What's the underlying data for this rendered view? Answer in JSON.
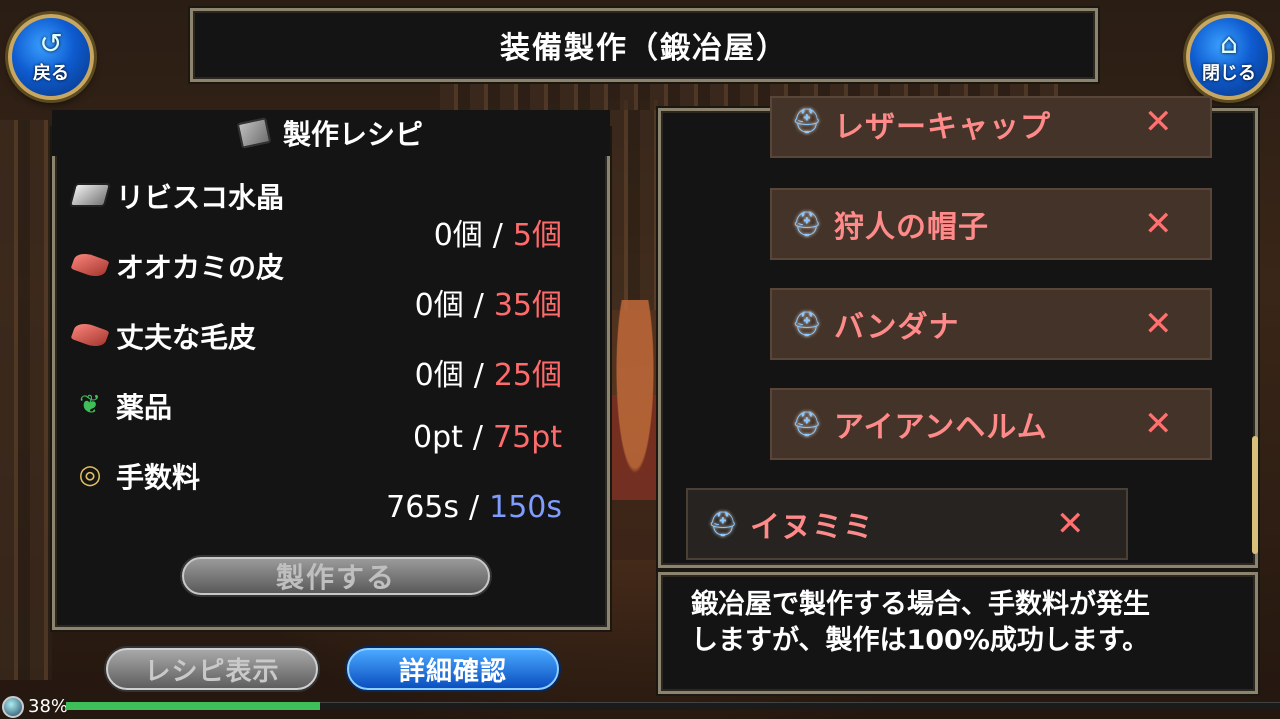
{
  "header": {
    "title": "装備製作（鍛冶屋）"
  },
  "nav": {
    "back_label": "戻る",
    "close_label": "閉じる"
  },
  "recipe": {
    "title": "製作レシピ",
    "materials": [
      {
        "name": "リビスコ水晶",
        "have": "0個",
        "need": "5個",
        "icon": "crystal-icon"
      },
      {
        "name": "オオカミの皮",
        "have": "0個",
        "need": "35個",
        "icon": "wolf-hide-icon"
      },
      {
        "name": "丈夫な毛皮",
        "have": "0個",
        "need": "25個",
        "icon": "fur-icon"
      },
      {
        "name": "薬品",
        "have": "0pt",
        "need": "75pt",
        "icon": "herb-icon"
      },
      {
        "name": "手数料",
        "have": "765s",
        "need": "150s",
        "icon": "coin-icon"
      }
    ],
    "separator": "/",
    "craft_label": "製作する",
    "recipe_view_label": "レシピ表示",
    "detail_label": "詳細確認"
  },
  "list": {
    "items": [
      {
        "name": "レザーキャップ",
        "mark": "✕"
      },
      {
        "name": "狩人の帽子",
        "mark": "✕"
      },
      {
        "name": "バンダナ",
        "mark": "✕"
      },
      {
        "name": "アイアンヘルム",
        "mark": "✕"
      },
      {
        "name": "イヌミミ",
        "mark": "✕"
      }
    ]
  },
  "description": {
    "line1": "鍛冶屋で製作する場合、手数料が発生",
    "line2": "しますが、製作は100%成功します。"
  },
  "status": {
    "percent_label": "38%",
    "progress": 0.38
  },
  "colors": {
    "need_short": "#ff6b6b",
    "need_ok": "#7f9cff",
    "item_name": "#ff8a8a"
  }
}
